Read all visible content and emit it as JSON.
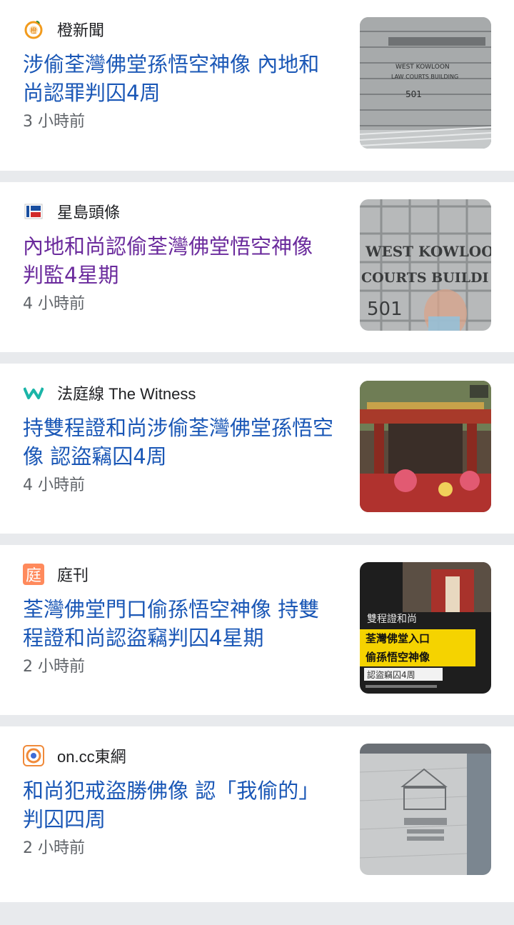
{
  "articles": [
    {
      "source": "橙新聞",
      "logo_icon": "orange-news-logo-icon",
      "headline": "涉偷荃灣佛堂孫悟空神像 內地和尚認罪判囚4周",
      "time": "3 小時前",
      "thumbnail": "court-building-thumbnail",
      "thumbnail_text": [
        "WEST KOWLOON",
        "LAW COURTS BUILDING",
        "501"
      ]
    },
    {
      "source": "星島頭條",
      "logo_icon": "sing-tao-logo-icon",
      "headline": "內地和尚認偷荃灣佛堂悟空神像 判監4星期",
      "time": "4 小時前",
      "visited": true,
      "thumbnail": "court-sign-thumbnail",
      "thumbnail_text": [
        "WEST KOWLOON",
        "COURTS BUILDI",
        "501"
      ]
    },
    {
      "source": "法庭線 The Witness",
      "logo_icon": "the-witness-logo-icon",
      "headline": "持雙程證和尚涉偷荃灣佛堂孫悟空像 認盜竊囚4周",
      "time": "4 小時前",
      "thumbnail": "temple-gate-thumbnail"
    },
    {
      "source": "庭刊",
      "logo_icon": "court-news-logo-icon",
      "headline": "荃灣佛堂門口偷孫悟空神像 持雙程證和尚認盜竊判囚4星期",
      "time": "2 小時前",
      "thumbnail": "temple-caption-thumbnail",
      "thumbnail_text": [
        "雙程證和尚",
        "荃灣佛堂入口",
        "偷孫悟空神像",
        "認盜竊囚4周"
      ]
    },
    {
      "source": "on.cc東網",
      "logo_icon": "on-cc-logo-icon",
      "headline": "和尚犯戒盜勝佛像 認「我偷的」判囚四周",
      "time": "2 小時前",
      "thumbnail": "judiciary-building-thumbnail"
    }
  ],
  "colors": {
    "headline": "#1a57b6",
    "headline_visited": "#6a2a9c",
    "time": "#5f6368",
    "separator": "#e8eaed"
  }
}
